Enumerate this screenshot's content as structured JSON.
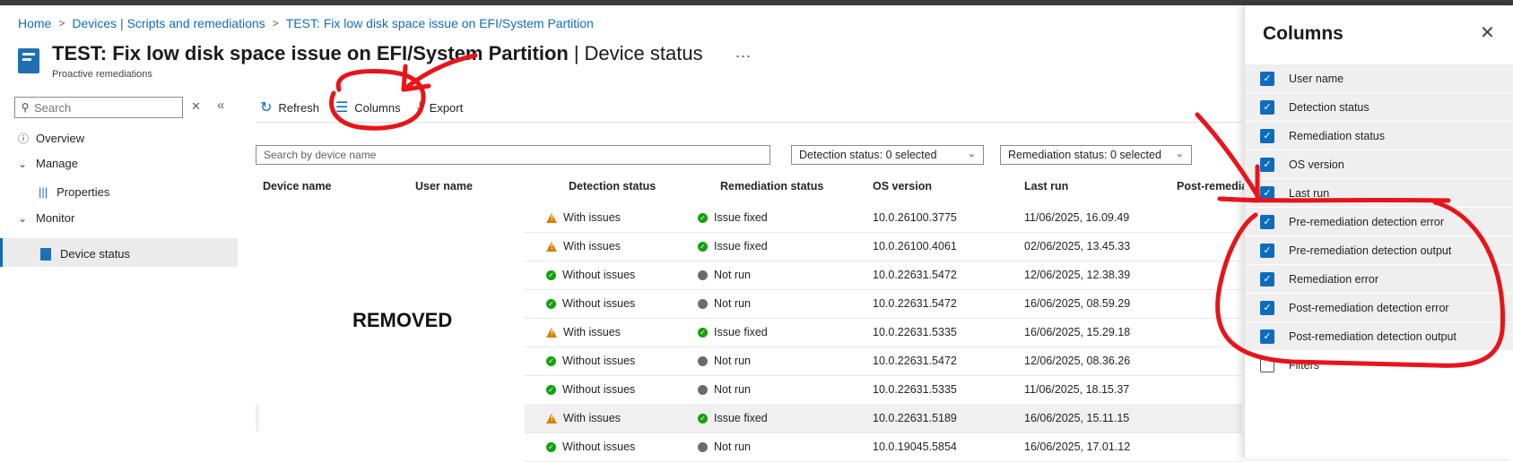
{
  "breadcrumb": [
    "Home",
    "Devices | Scripts and remediations",
    "TEST: Fix low disk space issue on EFI/System Partition"
  ],
  "header": {
    "title": "TEST: Fix low disk space issue on EFI/System Partition",
    "separator": "|",
    "section": "Device status",
    "more": "...",
    "caption": "Proactive remediations"
  },
  "nav": {
    "search_placeholder": "Search",
    "items": [
      "Overview",
      "Manage",
      "Properties",
      "Monitor",
      "Device status"
    ]
  },
  "toolbar": {
    "refresh": "Refresh",
    "columns": "Columns",
    "export": "Export"
  },
  "filters": {
    "search_placeholder": "Search by device name",
    "detection": "Detection status: 0 selected",
    "remediation": "Remediation status: 0 selected"
  },
  "table": {
    "headers": [
      "Device name",
      "User name",
      "Detection status",
      "Remediation status",
      "OS version",
      "Last run",
      "Post-remedia"
    ],
    "rows": [
      {
        "detection": "With issues",
        "det_status": "warn",
        "remediation": "Issue fixed",
        "rem_status": "ok",
        "os": "10.0.26100.3775",
        "last_run": "11/06/2025, 16.09.49"
      },
      {
        "detection": "With issues",
        "det_status": "warn",
        "remediation": "Issue fixed",
        "rem_status": "ok",
        "os": "10.0.26100.4061",
        "last_run": "02/06/2025, 13.45.33"
      },
      {
        "detection": "Without issues",
        "det_status": "ok",
        "remediation": "Not run",
        "rem_status": "none",
        "os": "10.0.22631.5472",
        "last_run": "12/06/2025, 12.38.39"
      },
      {
        "detection": "Without issues",
        "det_status": "ok",
        "remediation": "Not run",
        "rem_status": "none",
        "os": "10.0.22631.5472",
        "last_run": "16/06/2025, 08.59.29"
      },
      {
        "detection": "With issues",
        "det_status": "warn",
        "remediation": "Issue fixed",
        "rem_status": "ok",
        "os": "10.0.22631.5335",
        "last_run": "16/06/2025, 15.29.18"
      },
      {
        "detection": "Without issues",
        "det_status": "ok",
        "remediation": "Not run",
        "rem_status": "none",
        "os": "10.0.22631.5472",
        "last_run": "12/06/2025, 08.36.26"
      },
      {
        "detection": "Without issues",
        "det_status": "ok",
        "remediation": "Not run",
        "rem_status": "none",
        "os": "10.0.22631.5335",
        "last_run": "11/06/2025, 18.15.37"
      },
      {
        "detection": "With issues",
        "det_status": "warn",
        "remediation": "Issue fixed",
        "rem_status": "ok",
        "os": "10.0.22631.5189",
        "last_run": "16/06/2025, 15.11.15"
      },
      {
        "detection": "Without issues",
        "det_status": "ok",
        "remediation": "Not run",
        "rem_status": "none",
        "os": "10.0.19045.5854",
        "last_run": "16/06/2025, 17.01.12"
      }
    ],
    "removed_label": "REMOVED"
  },
  "panel": {
    "title": "Columns",
    "columns": [
      {
        "label": "User name",
        "checked": true
      },
      {
        "label": "Detection status",
        "checked": true
      },
      {
        "label": "Remediation status",
        "checked": true
      },
      {
        "label": "OS version",
        "checked": true
      },
      {
        "label": "Last run",
        "checked": true
      },
      {
        "label": "Pre-remediation detection error",
        "checked": true
      },
      {
        "label": "Pre-remediation detection output",
        "checked": true
      },
      {
        "label": "Remediation error",
        "checked": true
      },
      {
        "label": "Post-remediation detection error",
        "checked": true
      },
      {
        "label": "Post-remediation detection output",
        "checked": true
      },
      {
        "label": "Filters",
        "checked": false
      }
    ]
  },
  "colors": {
    "accent": "#0f6cbd",
    "ok": "#13a10e",
    "warn": "#d67f00",
    "annotation": "#e8141a"
  }
}
